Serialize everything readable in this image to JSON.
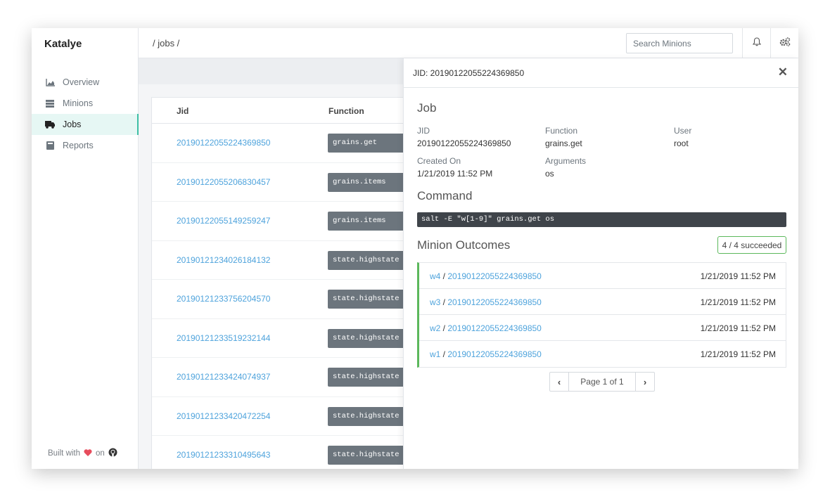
{
  "app": {
    "title": "Katalye"
  },
  "sidebar": {
    "items": [
      {
        "label": "Overview",
        "icon": "chart-area-icon",
        "active": false
      },
      {
        "label": "Minions",
        "icon": "server-icon",
        "active": false
      },
      {
        "label": "Jobs",
        "icon": "truck-icon",
        "active": true
      },
      {
        "label": "Reports",
        "icon": "book-icon",
        "active": false
      }
    ],
    "footer": {
      "prefix": "Built with",
      "middle": "on",
      "heart_color": "#e74c5c"
    }
  },
  "header": {
    "breadcrumb": "/ jobs /",
    "search_placeholder": "Search Minions"
  },
  "jobs_table": {
    "columns": [
      "Jid",
      "Function"
    ],
    "rows": [
      {
        "jid": "20190122055224369850",
        "function": "grains.get"
      },
      {
        "jid": "20190122055206830457",
        "function": "grains.items"
      },
      {
        "jid": "20190122055149259247",
        "function": "grains.items"
      },
      {
        "jid": "20190121234026184132",
        "function": "state.highstate"
      },
      {
        "jid": "20190121233756204570",
        "function": "state.highstate"
      },
      {
        "jid": "20190121233519232144",
        "function": "state.highstate"
      },
      {
        "jid": "20190121233424074937",
        "function": "state.highstate"
      },
      {
        "jid": "20190121233420472254",
        "function": "state.highstate"
      },
      {
        "jid": "20190121233310495643",
        "function": "state.highstate"
      }
    ]
  },
  "detail": {
    "title": "JID: 20190122055224369850",
    "job_heading": "Job",
    "fields": {
      "jid_label": "JID",
      "jid": "20190122055224369850",
      "function_label": "Function",
      "function": "grains.get",
      "user_label": "User",
      "user": "root",
      "created_label": "Created On",
      "created": "1/21/2019 11:52 PM",
      "arguments_label": "Arguments",
      "arguments": "os"
    },
    "command_heading": "Command",
    "command": "salt -E \"w[1-9]\" grains.get os",
    "outcomes_heading": "Minion Outcomes",
    "succeeded_badge": "4 / 4 succeeded",
    "outcomes": [
      {
        "minion": "w4",
        "jid": "20190122055224369850",
        "time": "1/21/2019 11:52 PM"
      },
      {
        "minion": "w3",
        "jid": "20190122055224369850",
        "time": "1/21/2019 11:52 PM"
      },
      {
        "minion": "w2",
        "jid": "20190122055224369850",
        "time": "1/21/2019 11:52 PM"
      },
      {
        "minion": "w1",
        "jid": "20190122055224369850",
        "time": "1/21/2019 11:52 PM"
      }
    ],
    "pager": {
      "info": "Page 1 of 1",
      "prev": "‹",
      "next": "›"
    }
  },
  "colors": {
    "accent": "#3dbfa4",
    "link": "#4ea3dc",
    "success": "#5cb85c",
    "badge_bg": "#6c757d",
    "command_bg": "#3f444a"
  }
}
